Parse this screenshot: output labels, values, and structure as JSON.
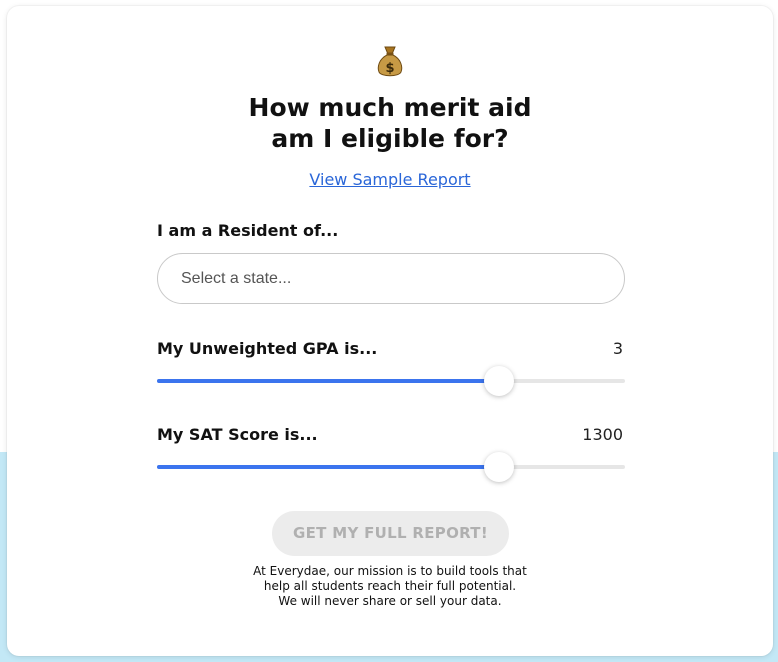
{
  "header": {
    "icon": "money-bag-icon",
    "title_line1": "How much merit aid",
    "title_line2": "am I eligible for?",
    "sample_link": "View Sample Report"
  },
  "residency": {
    "label": "I am a Resident of...",
    "placeholder": "Select a state..."
  },
  "gpa": {
    "label": "My Unweighted GPA is...",
    "value": "3",
    "fill_fraction": 0.73
  },
  "sat": {
    "label": "My SAT Score is...",
    "value": "1300",
    "fill_fraction": 0.73
  },
  "cta": {
    "label": "GET MY FULL REPORT!"
  },
  "footer": {
    "line1": "At Everydae, our mission is to build tools that",
    "line2": "help all students reach their full potential.",
    "line3": "We will never share or sell your data."
  },
  "colors": {
    "accent": "#3b74ee",
    "link": "#2a66d8",
    "background_band": "#c3e8f6",
    "button_disabled_bg": "#ececec",
    "button_disabled_text": "#b0b0b0"
  }
}
